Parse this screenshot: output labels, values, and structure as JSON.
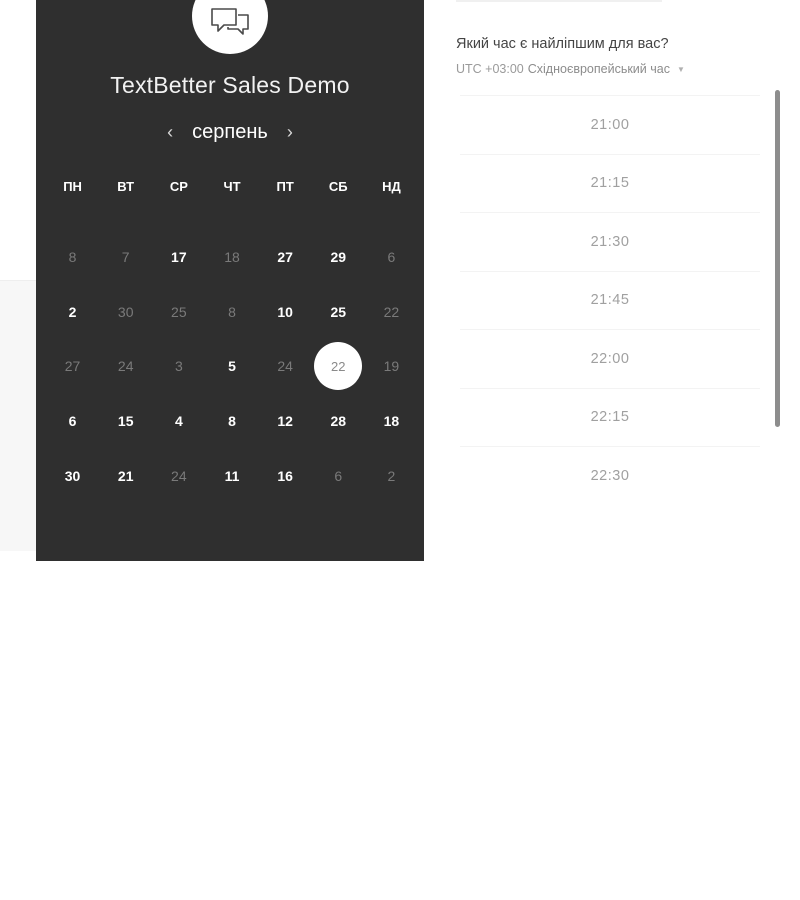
{
  "event": {
    "title": "TextBetter Sales Demo",
    "icon": "chat-bubbles-icon"
  },
  "calendar": {
    "month": "серпень",
    "prev_icon": "‹",
    "next_icon": "›",
    "weekdays": [
      "ПН",
      "ВТ",
      "СР",
      "ЧТ",
      "ПТ",
      "СБ",
      "НД"
    ],
    "weeks": [
      [
        {
          "d": "8",
          "e": false
        },
        {
          "d": "7",
          "e": false
        },
        {
          "d": "17",
          "e": true
        },
        {
          "d": "18",
          "e": false
        },
        {
          "d": "27",
          "e": true
        },
        {
          "d": "29",
          "e": true
        },
        {
          "d": "6",
          "e": false
        }
      ],
      [
        {
          "d": "2",
          "e": true
        },
        {
          "d": "30",
          "e": false
        },
        {
          "d": "25",
          "e": false
        },
        {
          "d": "8",
          "e": false
        },
        {
          "d": "10",
          "e": true
        },
        {
          "d": "25",
          "e": true
        },
        {
          "d": "22",
          "e": false
        }
      ],
      [
        {
          "d": "27",
          "e": false
        },
        {
          "d": "24",
          "e": false
        },
        {
          "d": "3",
          "e": false
        },
        {
          "d": "5",
          "e": true
        },
        {
          "d": "24",
          "e": false
        },
        {
          "d": "22",
          "e": true,
          "sel": true
        },
        {
          "d": "19",
          "e": false
        }
      ],
      [
        {
          "d": "6",
          "e": true
        },
        {
          "d": "15",
          "e": true
        },
        {
          "d": "4",
          "e": true
        },
        {
          "d": "8",
          "e": true
        },
        {
          "d": "12",
          "e": true
        },
        {
          "d": "28",
          "e": true
        },
        {
          "d": "18",
          "e": true
        }
      ],
      [
        {
          "d": "30",
          "e": true
        },
        {
          "d": "21",
          "e": true
        },
        {
          "d": "24",
          "e": false
        },
        {
          "d": "11",
          "e": true
        },
        {
          "d": "16",
          "e": true
        },
        {
          "d": "6",
          "e": false
        },
        {
          "d": "2",
          "e": false
        }
      ]
    ]
  },
  "schedule": {
    "question": "Який час є найліпшим для вас?",
    "timezone_offset": "UTC +03:00",
    "timezone_name": "Східноєвропейський час",
    "timezone_caret": "▼",
    "slots": [
      "21:00",
      "21:15",
      "21:30",
      "21:45",
      "22:00",
      "22:15",
      "22:30"
    ]
  },
  "colors": {
    "panel": "#2f2f2f",
    "selected_bg": "#ffffff",
    "muted_day": "#7a7a7a"
  }
}
